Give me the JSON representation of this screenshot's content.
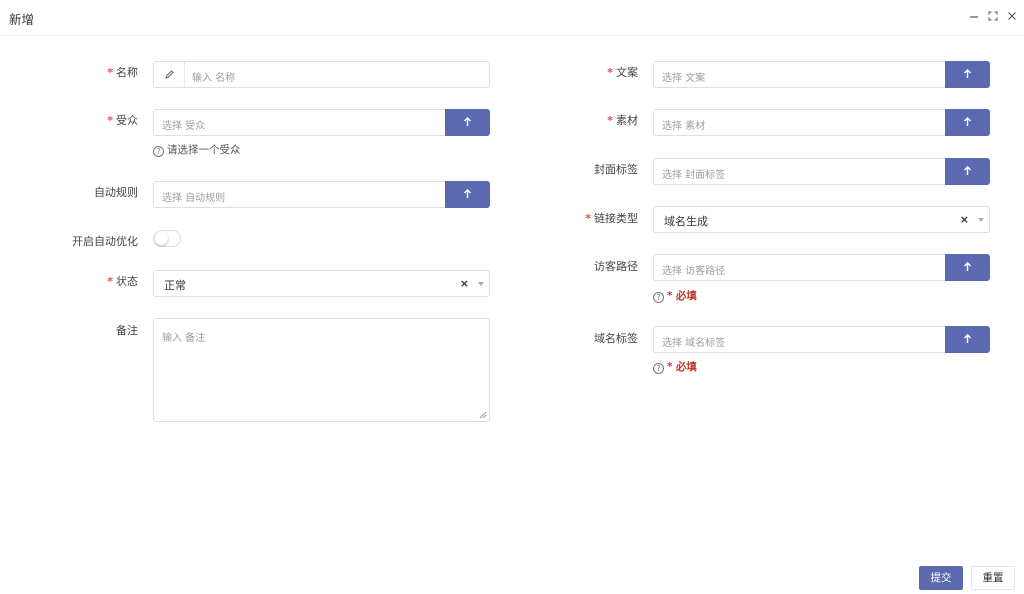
{
  "dialog": {
    "title": "新增",
    "window_controls": [
      "minimize-icon",
      "fullscreen-icon",
      "close-icon"
    ]
  },
  "left": {
    "name": {
      "label": "名称",
      "required": true,
      "placeholder": "输入 名称",
      "icon": "pencil-icon"
    },
    "audience": {
      "label": "受众",
      "required": true,
      "placeholder": "选择 受众",
      "help": "请选择一个受众",
      "button_icon": "arrow-up-icon"
    },
    "auto_rule": {
      "label": "自动规则",
      "required": false,
      "placeholder": "选择 自动规则",
      "button_icon": "arrow-up-icon"
    },
    "auto_optimize": {
      "label": "开启自动优化",
      "enabled": false
    },
    "status": {
      "label": "状态",
      "required": true,
      "value": "正常",
      "clear": "×"
    },
    "remark": {
      "label": "备注",
      "placeholder": "输入 备注"
    }
  },
  "right": {
    "copy": {
      "label": "文案",
      "required": true,
      "placeholder": "选择 文案",
      "button_icon": "arrow-up-icon"
    },
    "material": {
      "label": "素材",
      "required": true,
      "placeholder": "选择 素材",
      "button_icon": "arrow-up-icon"
    },
    "cover_tag": {
      "label": "封面标签",
      "required": false,
      "placeholder": "选择 封面标签",
      "button_icon": "arrow-up-icon"
    },
    "link_type": {
      "label": "链接类型",
      "required": true,
      "value": "域名生成",
      "clear": "×"
    },
    "visitor_path": {
      "label": "访客路径",
      "required": false,
      "placeholder": "选择 访客路径",
      "help_prefix": "*",
      "help": "必填",
      "button_icon": "arrow-up-icon"
    },
    "domain_tag": {
      "label": "域名标签",
      "required": false,
      "placeholder": "选择 域名标签",
      "help_prefix": "*",
      "help": "必填",
      "button_icon": "arrow-up-icon"
    }
  },
  "footer": {
    "submit_label": "提交",
    "reset_label": "重置"
  },
  "colors": {
    "primary": "#5b6ab0",
    "required": "#e5484d",
    "must": "#c0392b",
    "border": "#dcdfe6"
  }
}
